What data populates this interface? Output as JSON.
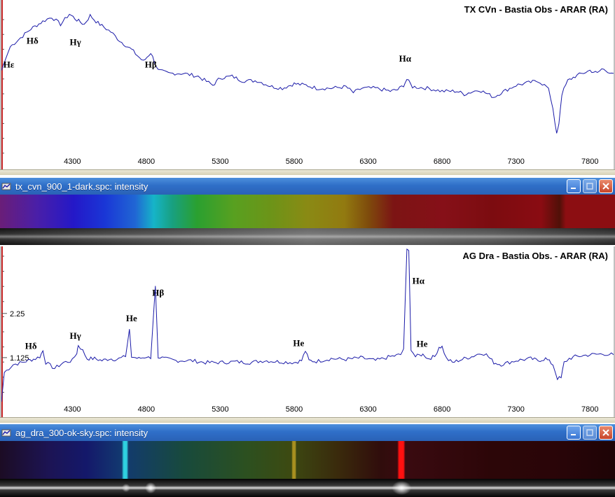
{
  "chart_data": [
    {
      "type": "line",
      "title": "TX CVn - Bastia Obs - ARAR (RA)",
      "xlim": [
        3820,
        7960
      ],
      "ylim": [
        0,
        1
      ],
      "x_ticks": [
        4300,
        4800,
        5300,
        5800,
        6300,
        6800,
        7300,
        7800
      ],
      "x_tick_labels": [
        "4300",
        "4800",
        "5300",
        "5800",
        "6300",
        "6800",
        "7300",
        "7800"
      ],
      "series": [
        {
          "x": [
            3820,
            3880,
            3950,
            4020,
            4100,
            4160,
            4220,
            4280,
            4330,
            4380,
            4420,
            4460,
            4500,
            4560,
            4620,
            4700,
            4780,
            4830,
            4880,
            4950,
            5050,
            5150,
            5250,
            5300,
            5380,
            5450,
            5550,
            5650,
            5720,
            5800,
            5880,
            5950,
            6050,
            6150,
            6200,
            6260,
            6350,
            6450,
            6500,
            6540,
            6562,
            6600,
            6700,
            6800,
            6900,
            6950,
            7050,
            7150,
            7200,
            7300,
            7400,
            7450,
            7520,
            7550,
            7575,
            7590,
            7610,
            7650,
            7700,
            7800,
            7850,
            7880,
            7960
          ],
          "y": [
            0.62,
            0.78,
            0.84,
            0.9,
            0.95,
            0.98,
            0.93,
            1.0,
            0.96,
            0.93,
            0.99,
            0.95,
            0.92,
            0.88,
            0.82,
            0.76,
            0.68,
            0.74,
            0.62,
            0.6,
            0.6,
            0.58,
            0.52,
            0.57,
            0.58,
            0.55,
            0.55,
            0.51,
            0.5,
            0.53,
            0.52,
            0.5,
            0.5,
            0.51,
            0.47,
            0.5,
            0.5,
            0.48,
            0.49,
            0.52,
            0.56,
            0.51,
            0.5,
            0.48,
            0.48,
            0.46,
            0.49,
            0.44,
            0.47,
            0.52,
            0.54,
            0.55,
            0.5,
            0.35,
            0.2,
            0.26,
            0.46,
            0.55,
            0.58,
            0.62,
            0.6,
            0.63,
            0.6
          ]
        }
      ],
      "annotations": [
        {
          "label": "Hε",
          "x": 3870,
          "y": 0.64
        },
        {
          "label": "Hδ",
          "x": 4030,
          "y": 0.8
        },
        {
          "label": "Hγ",
          "x": 4320,
          "y": 0.79
        },
        {
          "label": "Hβ",
          "x": 4830,
          "y": 0.64
        },
        {
          "label": "Hα",
          "x": 6550,
          "y": 0.68
        }
      ]
    },
    {
      "type": "line",
      "title": "AG Dra - Bastia Obs. - ARAR (RA)",
      "xlim": [
        3820,
        7960
      ],
      "ylim": [
        0,
        3.85
      ],
      "x_ticks": [
        4300,
        4800,
        5300,
        5800,
        6300,
        6800,
        7300,
        7800
      ],
      "x_tick_labels": [
        "4300",
        "4800",
        "5300",
        "5800",
        "6300",
        "6800",
        "7300",
        "7800"
      ],
      "y_ticks": [
        1.125,
        2.25
      ],
      "y_tick_labels": [
        "1.125",
        "2.25"
      ],
      "series": [
        {
          "x": [
            3820,
            3840,
            3900,
            3960,
            4000,
            4050,
            4080,
            4101,
            4120,
            4180,
            4240,
            4300,
            4330,
            4340,
            4370,
            4400,
            4450,
            4500,
            4550,
            4600,
            4660,
            4686,
            4700,
            4750,
            4800,
            4830,
            4861,
            4880,
            4920,
            5000,
            5100,
            5200,
            5300,
            5400,
            5500,
            5600,
            5700,
            5800,
            5850,
            5876,
            5900,
            5950,
            6050,
            6150,
            6250,
            6350,
            6450,
            6520,
            6540,
            6562,
            6575,
            6590,
            6620,
            6660,
            6680,
            6700,
            6750,
            6780,
            6800,
            6830,
            6870,
            6950,
            7000,
            7065,
            7100,
            7150,
            7200,
            7300,
            7400,
            7450,
            7500,
            7550,
            7580,
            7605,
            7625,
            7660,
            7700,
            7800,
            7900,
            7960
          ],
          "y": [
            0.0,
            0.75,
            0.95,
            1.0,
            1.05,
            1.1,
            1.15,
            1.3,
            1.0,
            0.85,
            1.0,
            1.05,
            1.25,
            1.45,
            1.3,
            1.1,
            1.1,
            1.05,
            1.1,
            1.08,
            1.15,
            1.85,
            1.15,
            1.1,
            1.15,
            1.1,
            2.95,
            1.15,
            1.1,
            1.05,
            1.05,
            1.0,
            1.0,
            1.02,
            1.0,
            1.05,
            1.02,
            1.0,
            1.05,
            1.3,
            1.05,
            1.03,
            1.1,
            1.08,
            1.12,
            1.05,
            1.15,
            1.2,
            1.35,
            3.85,
            3.85,
            1.35,
            1.15,
            1.2,
            1.2,
            1.1,
            1.15,
            1.4,
            1.4,
            1.1,
            1.0,
            1.1,
            1.15,
            1.25,
            1.2,
            1.0,
            0.95,
            1.05,
            1.1,
            1.05,
            1.1,
            0.95,
            0.6,
            0.6,
            1.0,
            1.1,
            1.15,
            1.2,
            1.22,
            1.2
          ]
        }
      ],
      "annotations": [
        {
          "label": "Hδ",
          "x": 4020,
          "y": 1.35
        },
        {
          "label": "Hγ",
          "x": 4320,
          "y": 1.6
        },
        {
          "label": "He",
          "x": 4700,
          "y": 2.05
        },
        {
          "label": "Hβ",
          "x": 4880,
          "y": 2.7
        },
        {
          "label": "He",
          "x": 5830,
          "y": 1.42
        },
        {
          "label": "Hα",
          "x": 6640,
          "y": 3.0
        },
        {
          "label": "He",
          "x": 6665,
          "y": 1.4
        }
      ]
    }
  ],
  "windows": [
    {
      "title": "tx_cvn_900_1-dark.spc: intensity"
    },
    {
      "title": "ag_dra_300-ok-sky.spc: intensity"
    }
  ],
  "icons": {
    "window": "spectrum-window-icon",
    "minimize": "minimize-icon",
    "maximize": "maximize-icon",
    "close": "close-icon"
  },
  "colors": {
    "line": "#1a1aa8",
    "titlebar": "#2f6fc8",
    "close": "#c8452a"
  }
}
